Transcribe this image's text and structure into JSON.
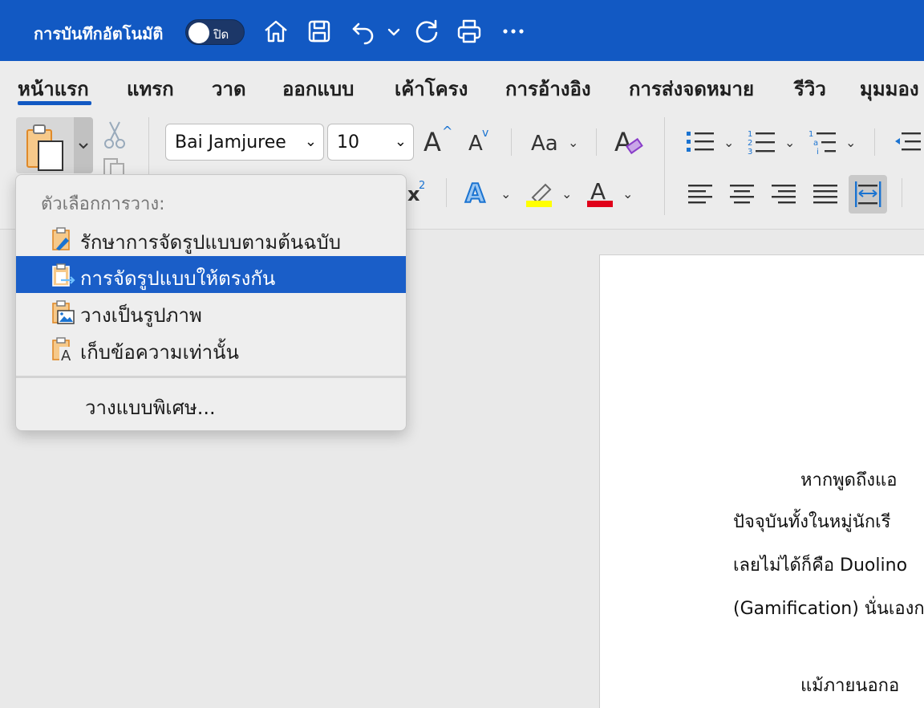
{
  "titlebar": {
    "autosave_label": "การบันทึกอัตโนมัติ",
    "autosave_state": "ปิด",
    "icons": [
      "home-icon",
      "save-icon",
      "undo-icon",
      "chevron-down-icon",
      "redo-icon",
      "print-icon",
      "more-icon"
    ],
    "background_color": "#1259c3"
  },
  "tabs": [
    {
      "label": "หน้าแรก",
      "active": true
    },
    {
      "label": "แทรก"
    },
    {
      "label": "วาด"
    },
    {
      "label": "ออกแบบ"
    },
    {
      "label": "เค้าโครง"
    },
    {
      "label": "การอ้างอิง"
    },
    {
      "label": "การส่งจดหมาย"
    },
    {
      "label": "รีวิว"
    },
    {
      "label": "มุมมอง"
    }
  ],
  "ribbon": {
    "font_name": "Bai Jamjuree",
    "font_size": "10",
    "grow_font_label": "A",
    "shrink_font_label": "A",
    "change_case_label": "Aa",
    "clear_format_label": "A",
    "superscript_label": "x",
    "superscript_mark": "2",
    "text_effects_label": "A",
    "font_color_label": "A",
    "highlight_color": "#ffff00",
    "font_color": "#e0001a"
  },
  "paste_menu": {
    "header": "ตัวเลือกการวาง:",
    "items": [
      {
        "label": "รักษาการจัดรูปแบบตามต้นฉบับ",
        "icon": "keep-source-formatting-icon"
      },
      {
        "label": "การจัดรูปแบบให้ตรงกัน",
        "icon": "merge-formatting-icon",
        "selected": true
      },
      {
        "label": "วางเป็นรูปภาพ",
        "icon": "paste-as-picture-icon"
      },
      {
        "label": "เก็บข้อความเท่านั้น",
        "icon": "keep-text-only-icon"
      }
    ],
    "paste_special": "วางแบบพิเศษ...",
    "selected_color": "#1a5ec8"
  },
  "document": {
    "lines": [
      "หากพูดถึงแอ",
      "ปัจจุบันทั้งในหมู่นักเรี",
      "เลยไม่ได้ก็คือ Duolino",
      "(Gamification) นั่นเองก",
      "แม้ภายนอกอ"
    ]
  }
}
